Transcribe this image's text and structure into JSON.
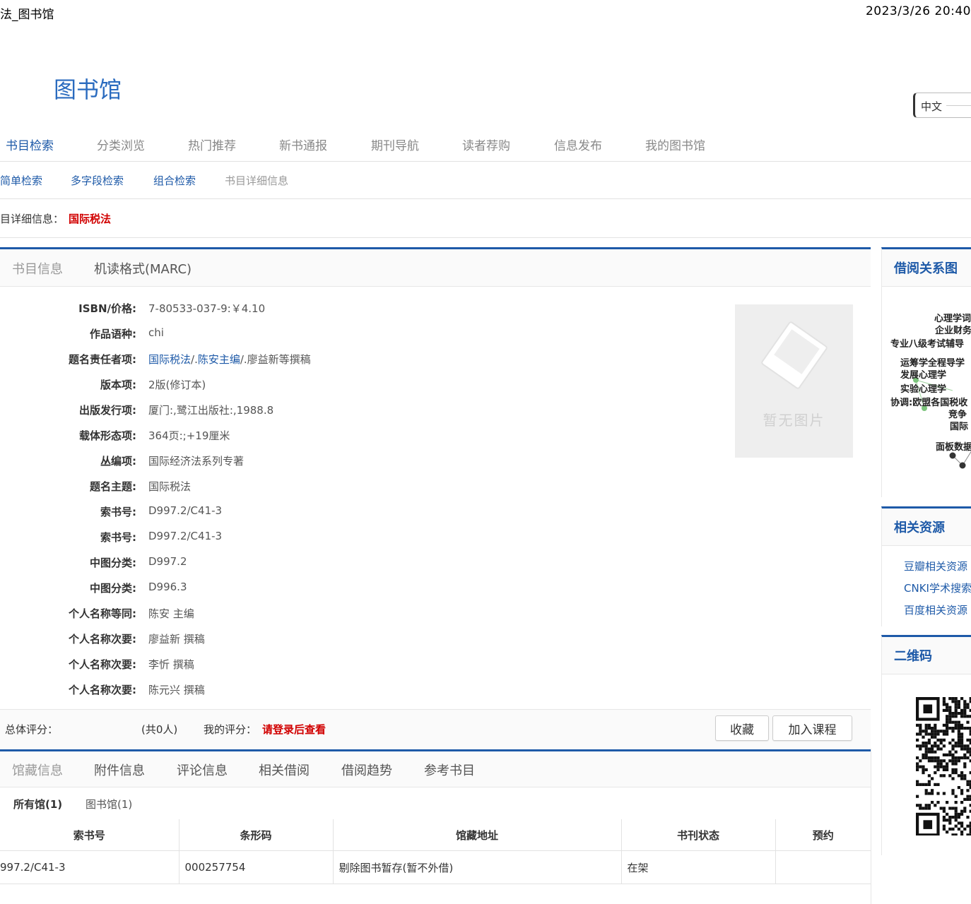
{
  "print_header": {
    "title": "法_图书馆",
    "datetime": "2023/3/26 20:40"
  },
  "site": {
    "logo": "图书馆",
    "language": "中文"
  },
  "main_nav": [
    "书目检索",
    "分类浏览",
    "热门推荐",
    "新书通报",
    "期刊导航",
    "读者荐购",
    "信息发布",
    "我的图书馆"
  ],
  "sub_nav": [
    "简单检索",
    "多字段检索",
    "组合检索",
    "书目详细信息"
  ],
  "breadcrumb": {
    "label": "目详细信息：",
    "title": "国际税法"
  },
  "detail_tabs": [
    "书目信息",
    "机读格式(MARC)"
  ],
  "fields": [
    {
      "label": "ISBN/价格:",
      "value": "7-80533-037-9:￥4.10"
    },
    {
      "label": "作品语种:",
      "value": "chi"
    },
    {
      "label": "题名责任者项:",
      "link1": "国际税法",
      "sep1": "/.",
      "link2": "陈安主编",
      "rest": "/.廖益新等撰稿"
    },
    {
      "label": "版本项:",
      "value": "2版(修订本)"
    },
    {
      "label": "出版发行项:",
      "value": "厦门:,鹭江出版社:,1988.8"
    },
    {
      "label": "载体形态项:",
      "value": "364页:;+19厘米"
    },
    {
      "label": "丛编项:",
      "value": "国际经济法系列专著"
    },
    {
      "label": "题名主题:",
      "value": "国际税法"
    },
    {
      "label": "索书号:",
      "value": "D997.2/C41-3"
    },
    {
      "label": "索书号:",
      "value": "D997.2/C41-3"
    },
    {
      "label": "中图分类:",
      "value": "D997.2"
    },
    {
      "label": "中图分类:",
      "value": "D996.3"
    },
    {
      "label": "个人名称等同:",
      "value": "陈安 主编"
    },
    {
      "label": "个人名称次要:",
      "value": "廖益新 撰稿"
    },
    {
      "label": "个人名称次要:",
      "value": "李忻 撰稿"
    },
    {
      "label": "个人名称次要:",
      "value": "陈元兴 撰稿"
    }
  ],
  "cover": {
    "placeholder": "暂无图片"
  },
  "rating": {
    "overall_label": "总体评分：",
    "count": "(共0人)",
    "my_label": "我的评分：",
    "login_prompt": "请登录后查看",
    "favorite_button": "收藏",
    "add_course_button": "加入课程"
  },
  "holdings_tabs": [
    "馆藏信息",
    "附件信息",
    "评论信息",
    "相关借阅",
    "借阅趋势",
    "参考书目"
  ],
  "library_tabs": [
    "所有馆(1)",
    "图书馆(1)"
  ],
  "holdings_table": {
    "headers": [
      "索书号",
      "条形码",
      "馆藏地址",
      "书刊状态",
      "预约"
    ],
    "rows": [
      [
        "997.2/C41-3",
        "000257754",
        "剔除图书暂存(暂不外借)",
        "在架",
        ""
      ]
    ]
  },
  "sidebar": {
    "graph": {
      "title": "借阅关系图",
      "nodes": [
        "心理学词",
        "企业财务",
        "专业八级考试辅导",
        "运筹学全程导学",
        "发展心理学",
        "实验心理学",
        "协调:欧盟各国税收",
        "竞争",
        "国际",
        "面板数据"
      ]
    },
    "resources": {
      "title": "相关资源",
      "links": [
        "豆瓣相关资源",
        "CNKI学术搜索",
        "百度相关资源"
      ]
    },
    "qrcode": {
      "title": "二维码"
    }
  },
  "colors": {
    "accent": "#1e5aa8",
    "alert": "#d10000"
  }
}
